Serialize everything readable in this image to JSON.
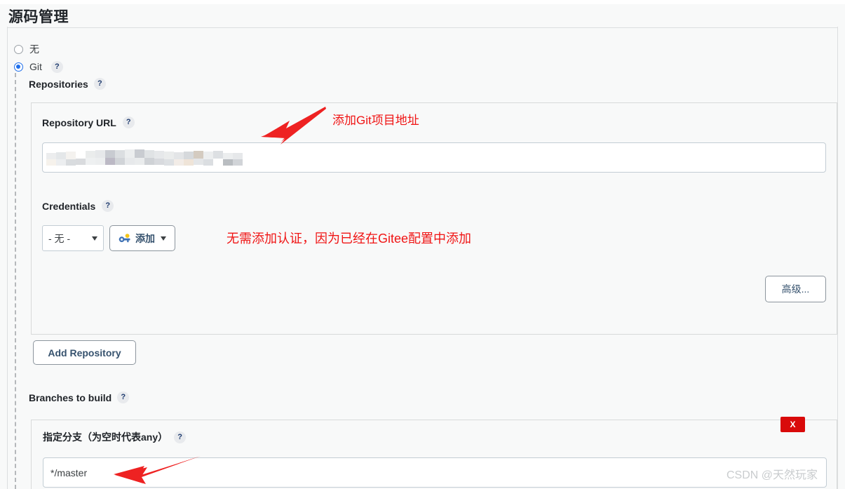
{
  "page": {
    "section_title": "源码管理"
  },
  "scm_options": [
    {
      "label": "无",
      "selected": false,
      "has_help": false
    },
    {
      "label": "Git",
      "selected": true,
      "has_help": true
    }
  ],
  "repositories": {
    "heading": "Repositories",
    "help": "?",
    "repository_url": {
      "label": "Repository URL",
      "help": "?",
      "value": "",
      "value_state": "blurred-mosaic"
    },
    "credentials": {
      "label": "Credentials",
      "help": "?",
      "selected": "- 无 -",
      "add_button": "添加",
      "add_icon": "key-icon",
      "dropdown_caret": "caret-down-icon"
    },
    "advanced_button": "高级...",
    "add_repository_button": "Add Repository"
  },
  "branches": {
    "heading": "Branches to build",
    "help": "?",
    "branch_spec": {
      "label": "指定分支（为空时代表any）",
      "help": "?",
      "value": "*/master"
    },
    "delete_button": "X"
  },
  "annotations": [
    {
      "text": "添加Git项目地址",
      "color": "#f01414"
    },
    {
      "text": "无需添加认证，因为已经在Gitee配置中添加",
      "color": "#f01414"
    }
  ],
  "watermark": "CSDN @天然玩家"
}
